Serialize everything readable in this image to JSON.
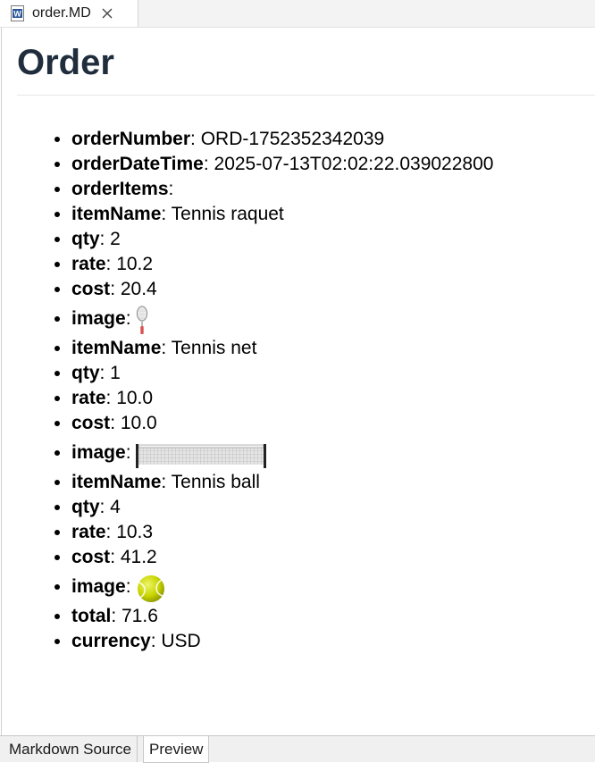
{
  "tab": {
    "title": "order.MD"
  },
  "document": {
    "heading": "Order",
    "items": [
      {
        "key": "orderNumber",
        "value": ": ORD-1752352342039"
      },
      {
        "key": "orderDateTime",
        "value": ": 2025-07-13T02:02:22.039022800"
      },
      {
        "key": "orderItems",
        "value": ":"
      },
      {
        "key": "itemName",
        "value": ": Tennis raquet"
      },
      {
        "key": "qty",
        "value": ": 2"
      },
      {
        "key": "rate",
        "value": ": 10.2"
      },
      {
        "key": "cost",
        "value": ": 20.4"
      },
      {
        "key": "image",
        "value": ":"
      },
      {
        "key": "itemName",
        "value": ": Tennis net"
      },
      {
        "key": "qty",
        "value": ": 1"
      },
      {
        "key": "rate",
        "value": ": 10.0"
      },
      {
        "key": "cost",
        "value": ": 10.0"
      },
      {
        "key": "image",
        "value": ":"
      },
      {
        "key": "itemName",
        "value": ": Tennis ball"
      },
      {
        "key": "qty",
        "value": ": 4"
      },
      {
        "key": "rate",
        "value": ": 10.3"
      },
      {
        "key": "cost",
        "value": ": 41.2"
      },
      {
        "key": "image",
        "value": ":"
      },
      {
        "key": "total",
        "value": ": 71.6"
      },
      {
        "key": "currency",
        "value": ": USD"
      }
    ]
  },
  "images": [
    "tennis-racket-image",
    "tennis-net-image",
    "tennis-ball-image"
  ],
  "bottom_tabs": {
    "source": "Markdown Source",
    "preview": "Preview"
  },
  "colors": {
    "heading": "#1f2d3d",
    "ball": "#c8d400"
  }
}
